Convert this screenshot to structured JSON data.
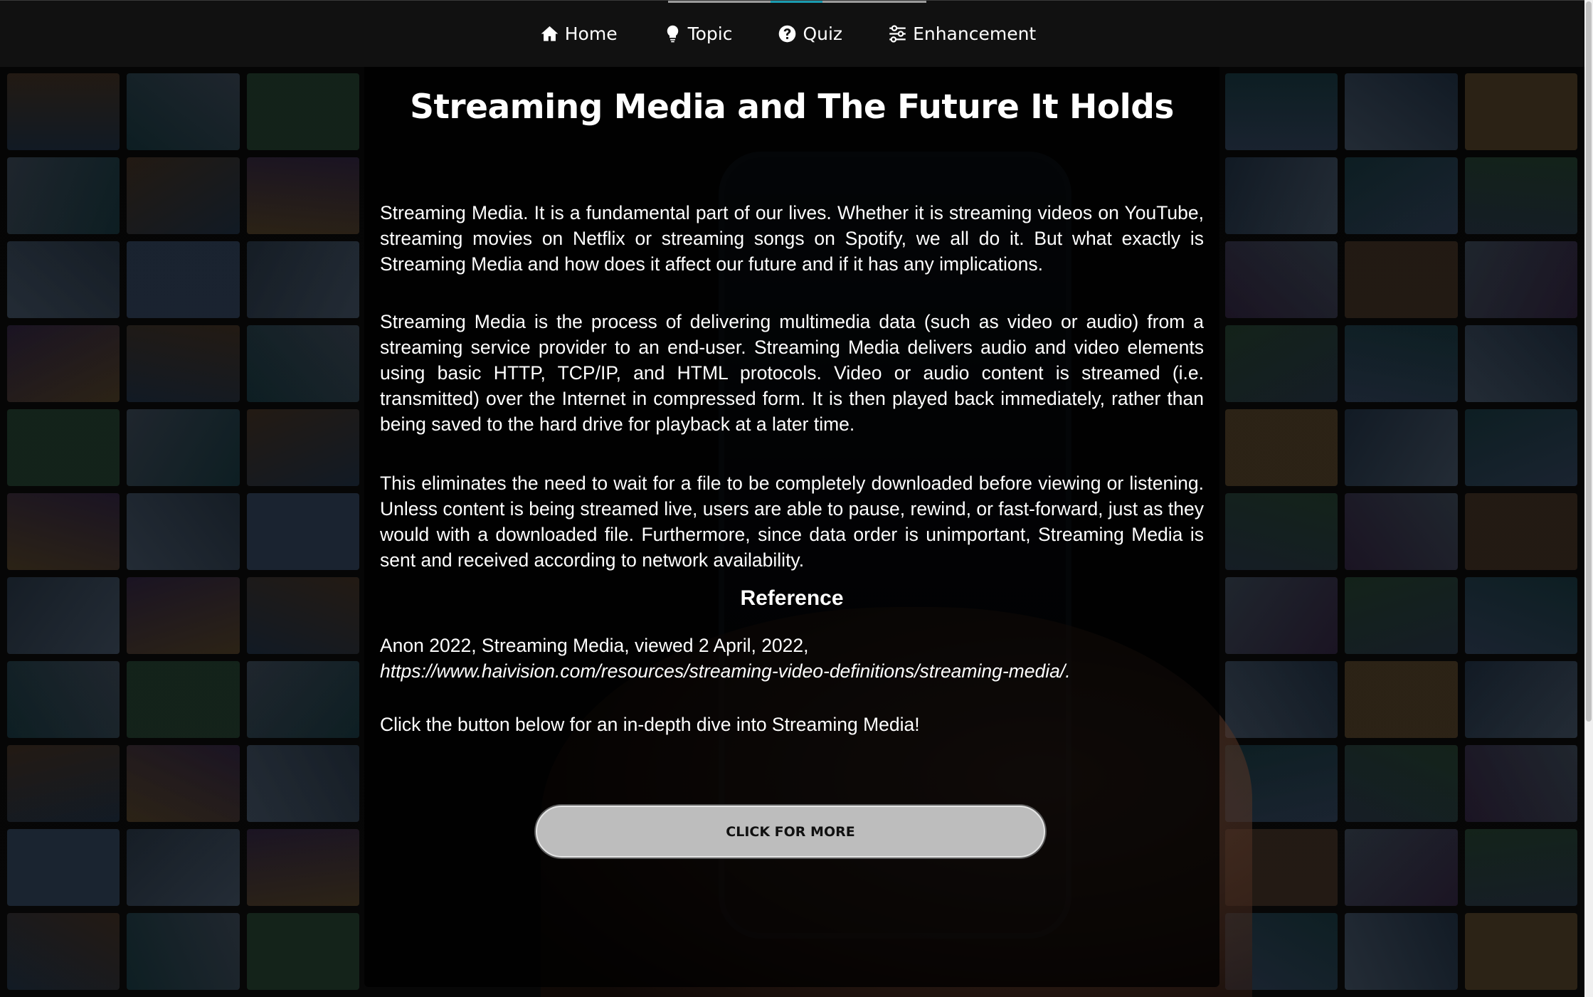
{
  "nav": {
    "items": [
      {
        "label": "Home",
        "icon": "home-icon"
      },
      {
        "label": "Topic",
        "icon": "lightbulb-icon"
      },
      {
        "label": "Quiz",
        "icon": "question-circle-icon"
      },
      {
        "label": "Enhancement",
        "icon": "sliders-icon"
      }
    ]
  },
  "main": {
    "title": "Streaming Media and The Future It Holds",
    "paragraphs": [
      "Streaming Media. It is a fundamental part of our lives. Whether it is streaming videos on YouTube, streaming movies on Netflix or streaming songs on Spotify, we all do it. But what exactly is Streaming Media and how does it affect our future and if it has any implications.",
      "Streaming Media is the process of delivering multimedia data (such as video or audio) from a streaming service provider to an end-user. Streaming Media delivers audio and video elements using basic HTTP, TCP/IP, and HTML protocols. Video or audio content is streamed (i.e. transmitted) over the Internet in compressed form. It is then played back immediately, rather than being saved to the hard drive for playback at a later time.",
      "This eliminates the need to wait for a file to be completely downloaded before viewing or listening. Unless content is being streamed live, users are able to pause, rewind, or fast-forward, just as they would with a downloaded file. Furthermore, since data order is unimportant, Streaming Media is sent and received according to network availability."
    ],
    "reference_heading": "Reference",
    "reference_line1": "Anon 2022, Streaming Media, viewed 2 April, 2022,",
    "reference_url": "https://www.haivision.com/resources/streaming-video-definitions/streaming-media/.",
    "cta_text": "Click the button below for an in-depth dive into Streaming Media!",
    "cta_button_label": "CLICK FOR MORE"
  },
  "colors": {
    "navbar": "#111111",
    "nav_active_accent": "#1a9bb0",
    "button_bg": "#bdbdbd",
    "text": "#ffffff"
  }
}
